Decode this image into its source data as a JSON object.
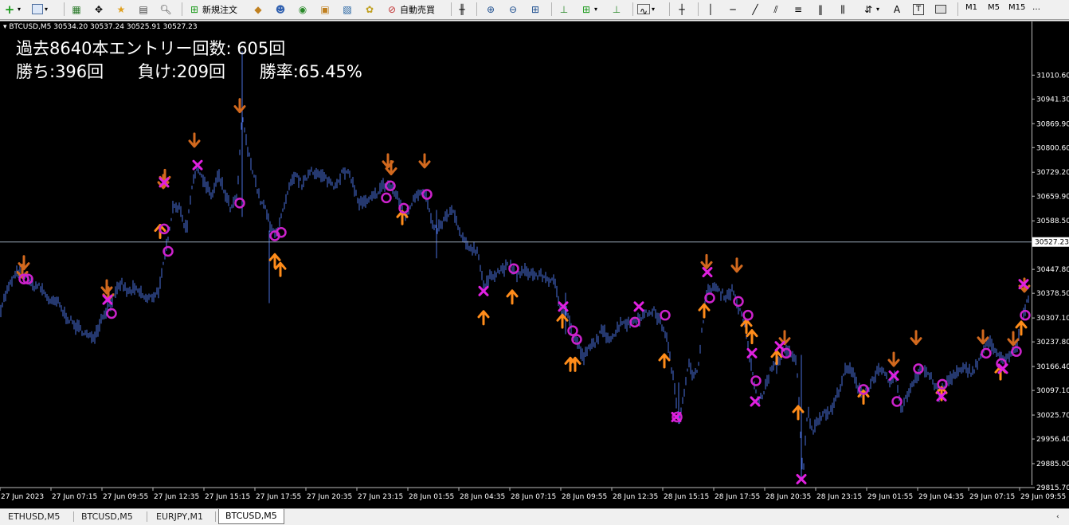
{
  "toolbar": {
    "new_order": "新規注文",
    "auto_trade": "自動売買",
    "timeframes": [
      "M1",
      "M5",
      "M15"
    ]
  },
  "chart": {
    "info": "▾ BTCUSD,M5   30534.20 30537.24 30525.91 30527.23",
    "stats_line1": "過去8640本エントリー回数: 605回",
    "wins": "勝ち:396回",
    "losses": "負け:209回",
    "win_rate": "勝率:65.45%",
    "current_price_label": "30527.23",
    "colors": {
      "bg": "#000000",
      "candle": "#4a6fdc",
      "up_arrow": "#ff8c1a",
      "down_arrow": "#d2691e",
      "circle": "#cc22cc",
      "cross": "#e020e0",
      "current_line": "#9aa7b8"
    }
  },
  "chart_data": {
    "type": "line",
    "title": "",
    "xlabel": "",
    "ylabel": "",
    "ylim": [
      29815.7,
      31110.6
    ],
    "y_ticks": [
      "31010.60",
      "30941.30",
      "30869.90",
      "30800.60",
      "30729.20",
      "30659.90",
      "30588.50",
      "30447.80",
      "30378.50",
      "30307.10",
      "30237.80",
      "30166.40",
      "30097.10",
      "30025.70",
      "29956.40",
      "29885.00",
      "29815.70"
    ],
    "x_ticks": [
      "27 Jun 2023",
      "27 Jun 07:15",
      "27 Jun 09:55",
      "27 Jun 12:35",
      "27 Jun 15:15",
      "27 Jun 17:55",
      "27 Jun 20:35",
      "27 Jun 23:15",
      "28 Jun 01:55",
      "28 Jun 04:35",
      "28 Jun 07:15",
      "28 Jun 09:55",
      "28 Jun 12:35",
      "28 Jun 15:15",
      "28 Jun 17:55",
      "28 Jun 20:35",
      "28 Jun 23:15",
      "29 Jun 01:55",
      "29 Jun 04:35",
      "29 Jun 07:15",
      "29 Jun 09:55"
    ],
    "current_price": 30527.23,
    "series": [
      {
        "values": [
          [
            0,
            30330
          ],
          [
            8,
            30380
          ],
          [
            16,
            30420
          ],
          [
            24,
            30445
          ],
          [
            32,
            30430
          ],
          [
            40,
            30400
          ],
          [
            48,
            30400
          ],
          [
            56,
            30380
          ],
          [
            64,
            30350
          ],
          [
            72,
            30355
          ],
          [
            80,
            30320
          ],
          [
            88,
            30300
          ],
          [
            96,
            30280
          ],
          [
            104,
            30270
          ],
          [
            112,
            30250
          ],
          [
            120,
            30260
          ],
          [
            128,
            30310
          ],
          [
            136,
            30340
          ],
          [
            144,
            30370
          ],
          [
            152,
            30410
          ],
          [
            160,
            30380
          ],
          [
            168,
            30390
          ],
          [
            176,
            30380
          ],
          [
            184,
            30360
          ],
          [
            192,
            30370
          ],
          [
            200,
            30390
          ],
          [
            206,
            30470
          ],
          [
            212,
            30560
          ],
          [
            218,
            30640
          ],
          [
            226,
            30620
          ],
          [
            234,
            30560
          ],
          [
            242,
            30710
          ],
          [
            250,
            30740
          ],
          [
            258,
            30690
          ],
          [
            266,
            30660
          ],
          [
            274,
            30720
          ],
          [
            282,
            30670
          ],
          [
            290,
            30620
          ],
          [
            298,
            30660
          ],
          [
            304,
            30900
          ],
          [
            310,
            30800
          ],
          [
            318,
            30730
          ],
          [
            326,
            30650
          ],
          [
            334,
            30620
          ],
          [
            340,
            30560
          ],
          [
            348,
            30560
          ],
          [
            356,
            30620
          ],
          [
            364,
            30690
          ],
          [
            372,
            30720
          ],
          [
            380,
            30690
          ],
          [
            390,
            30740
          ],
          [
            400,
            30720
          ],
          [
            410,
            30710
          ],
          [
            420,
            30690
          ],
          [
            430,
            30730
          ],
          [
            440,
            30720
          ],
          [
            450,
            30640
          ],
          [
            460,
            30640
          ],
          [
            470,
            30660
          ],
          [
            480,
            30690
          ],
          [
            490,
            30690
          ],
          [
            500,
            30650
          ],
          [
            510,
            30600
          ],
          [
            520,
            30660
          ],
          [
            530,
            30680
          ],
          [
            536,
            30650
          ],
          [
            544,
            30560
          ],
          [
            552,
            30570
          ],
          [
            560,
            30600
          ],
          [
            568,
            30620
          ],
          [
            576,
            30560
          ],
          [
            584,
            30520
          ],
          [
            592,
            30510
          ],
          [
            600,
            30500
          ],
          [
            608,
            30390
          ],
          [
            616,
            30430
          ],
          [
            624,
            30440
          ],
          [
            632,
            30450
          ],
          [
            640,
            30460
          ],
          [
            648,
            30430
          ],
          [
            656,
            30440
          ],
          [
            664,
            30440
          ],
          [
            672,
            30430
          ],
          [
            680,
            30430
          ],
          [
            688,
            30420
          ],
          [
            696,
            30410
          ],
          [
            704,
            30330
          ],
          [
            712,
            30330
          ],
          [
            718,
            30260
          ],
          [
            724,
            30240
          ],
          [
            732,
            30190
          ],
          [
            740,
            30220
          ],
          [
            748,
            30240
          ],
          [
            756,
            30270
          ],
          [
            764,
            30250
          ],
          [
            772,
            30260
          ],
          [
            780,
            30300
          ],
          [
            788,
            30290
          ],
          [
            796,
            30300
          ],
          [
            804,
            30310
          ],
          [
            812,
            30320
          ],
          [
            820,
            30330
          ],
          [
            828,
            30300
          ],
          [
            836,
            30260
          ],
          [
            844,
            30150
          ],
          [
            852,
            30010
          ],
          [
            858,
            30080
          ],
          [
            864,
            30180
          ],
          [
            870,
            30130
          ],
          [
            876,
            30160
          ],
          [
            882,
            30290
          ],
          [
            888,
            30380
          ],
          [
            896,
            30400
          ],
          [
            904,
            30380
          ],
          [
            912,
            30370
          ],
          [
            920,
            30390
          ],
          [
            928,
            30330
          ],
          [
            936,
            30280
          ],
          [
            944,
            30150
          ],
          [
            952,
            30060
          ],
          [
            960,
            30100
          ],
          [
            968,
            30160
          ],
          [
            976,
            30170
          ],
          [
            984,
            30220
          ],
          [
            992,
            30200
          ],
          [
            1000,
            30180
          ],
          [
            1008,
            29850
          ],
          [
            1014,
            30040
          ],
          [
            1020,
            29980
          ],
          [
            1028,
            30020
          ],
          [
            1036,
            30030
          ],
          [
            1044,
            30040
          ],
          [
            1052,
            30090
          ],
          [
            1060,
            30150
          ],
          [
            1068,
            30160
          ],
          [
            1076,
            30110
          ],
          [
            1084,
            30090
          ],
          [
            1092,
            30110
          ],
          [
            1100,
            30150
          ],
          [
            1108,
            30150
          ],
          [
            1116,
            30120
          ],
          [
            1124,
            30140
          ],
          [
            1132,
            30040
          ],
          [
            1140,
            30090
          ],
          [
            1148,
            30130
          ],
          [
            1156,
            30160
          ],
          [
            1164,
            30150
          ],
          [
            1172,
            30120
          ],
          [
            1180,
            30080
          ],
          [
            1188,
            30120
          ],
          [
            1196,
            30140
          ],
          [
            1204,
            30150
          ],
          [
            1212,
            30160
          ],
          [
            1220,
            30150
          ],
          [
            1228,
            30180
          ],
          [
            1236,
            30220
          ],
          [
            1244,
            30240
          ],
          [
            1252,
            30200
          ],
          [
            1260,
            30180
          ],
          [
            1268,
            30200
          ],
          [
            1276,
            30220
          ],
          [
            1282,
            30280
          ],
          [
            1288,
            30350
          ],
          [
            1294,
            30390
          ]
        ]
      }
    ],
    "signals": {
      "up_arrows": [
        [
          345,
          30475
        ],
        [
          352,
          30450
        ],
        [
          505,
          30600
        ],
        [
          607,
          30310
        ],
        [
          643,
          30370
        ],
        [
          706,
          30300
        ],
        [
          716,
          30175
        ],
        [
          722,
          30175
        ],
        [
          834,
          30185
        ],
        [
          884,
          30330
        ],
        [
          937,
          30285
        ],
        [
          944,
          30255
        ],
        [
          975,
          30195
        ],
        [
          1002,
          30035
        ],
        [
          1084,
          30080
        ],
        [
          1182,
          30090
        ],
        [
          1256,
          30150
        ],
        [
          1282,
          30280
        ],
        [
          201,
          30560
        ]
      ],
      "down_arrows": [
        [
          30,
          30465
        ],
        [
          134,
          30395
        ],
        [
          136,
          30375
        ],
        [
          244,
          30820
        ],
        [
          205,
          30700
        ],
        [
          207,
          30715
        ],
        [
          301,
          30920
        ],
        [
          487,
          30760
        ],
        [
          491,
          30740
        ],
        [
          533,
          30760
        ],
        [
          887,
          30468
        ],
        [
          925,
          30458
        ],
        [
          985,
          30248
        ],
        [
          1122,
          30185
        ],
        [
          1150,
          30248
        ],
        [
          1234,
          30250
        ],
        [
          1272,
          30245
        ],
        [
          1286,
          30400
        ],
        [
          28,
          30440
        ]
      ],
      "circles": [
        [
          30,
          30420
        ],
        [
          35,
          30420
        ],
        [
          140,
          30320
        ],
        [
          206,
          30565
        ],
        [
          211,
          30500
        ],
        [
          301,
          30640
        ],
        [
          345,
          30545
        ],
        [
          353,
          30555
        ],
        [
          485,
          30655
        ],
        [
          490,
          30690
        ],
        [
          507,
          30625
        ],
        [
          536,
          30665
        ],
        [
          645,
          30450
        ],
        [
          719,
          30270
        ],
        [
          724,
          30245
        ],
        [
          797,
          30295
        ],
        [
          835,
          30315
        ],
        [
          850,
          30020
        ],
        [
          891,
          30365
        ],
        [
          927,
          30355
        ],
        [
          939,
          30315
        ],
        [
          949,
          30125
        ],
        [
          987,
          30205
        ],
        [
          1084,
          30100
        ],
        [
          1126,
          30065
        ],
        [
          1153,
          30160
        ],
        [
          1183,
          30115
        ],
        [
          1238,
          30205
        ],
        [
          1257,
          30175
        ],
        [
          1276,
          30210
        ],
        [
          1287,
          30315
        ]
      ],
      "crosses": [
        [
          135,
          30360
        ],
        [
          206,
          30700
        ],
        [
          248,
          30750
        ],
        [
          607,
          30385
        ],
        [
          707,
          30340
        ],
        [
          802,
          30340
        ],
        [
          849,
          30020
        ],
        [
          888,
          30440
        ],
        [
          944,
          30205
        ],
        [
          948,
          30065
        ],
        [
          979,
          30225
        ],
        [
          1006,
          29840
        ],
        [
          1122,
          30140
        ],
        [
          1182,
          30080
        ],
        [
          1259,
          30160
        ],
        [
          1285,
          30405
        ]
      ]
    }
  },
  "tabs": [
    {
      "label": "ETHUSD,M5",
      "active": false
    },
    {
      "label": "BTCUSD,M5",
      "active": false
    },
    {
      "label": "EURJPY,M1",
      "active": false
    },
    {
      "label": "BTCUSD,M5",
      "active": true
    }
  ]
}
